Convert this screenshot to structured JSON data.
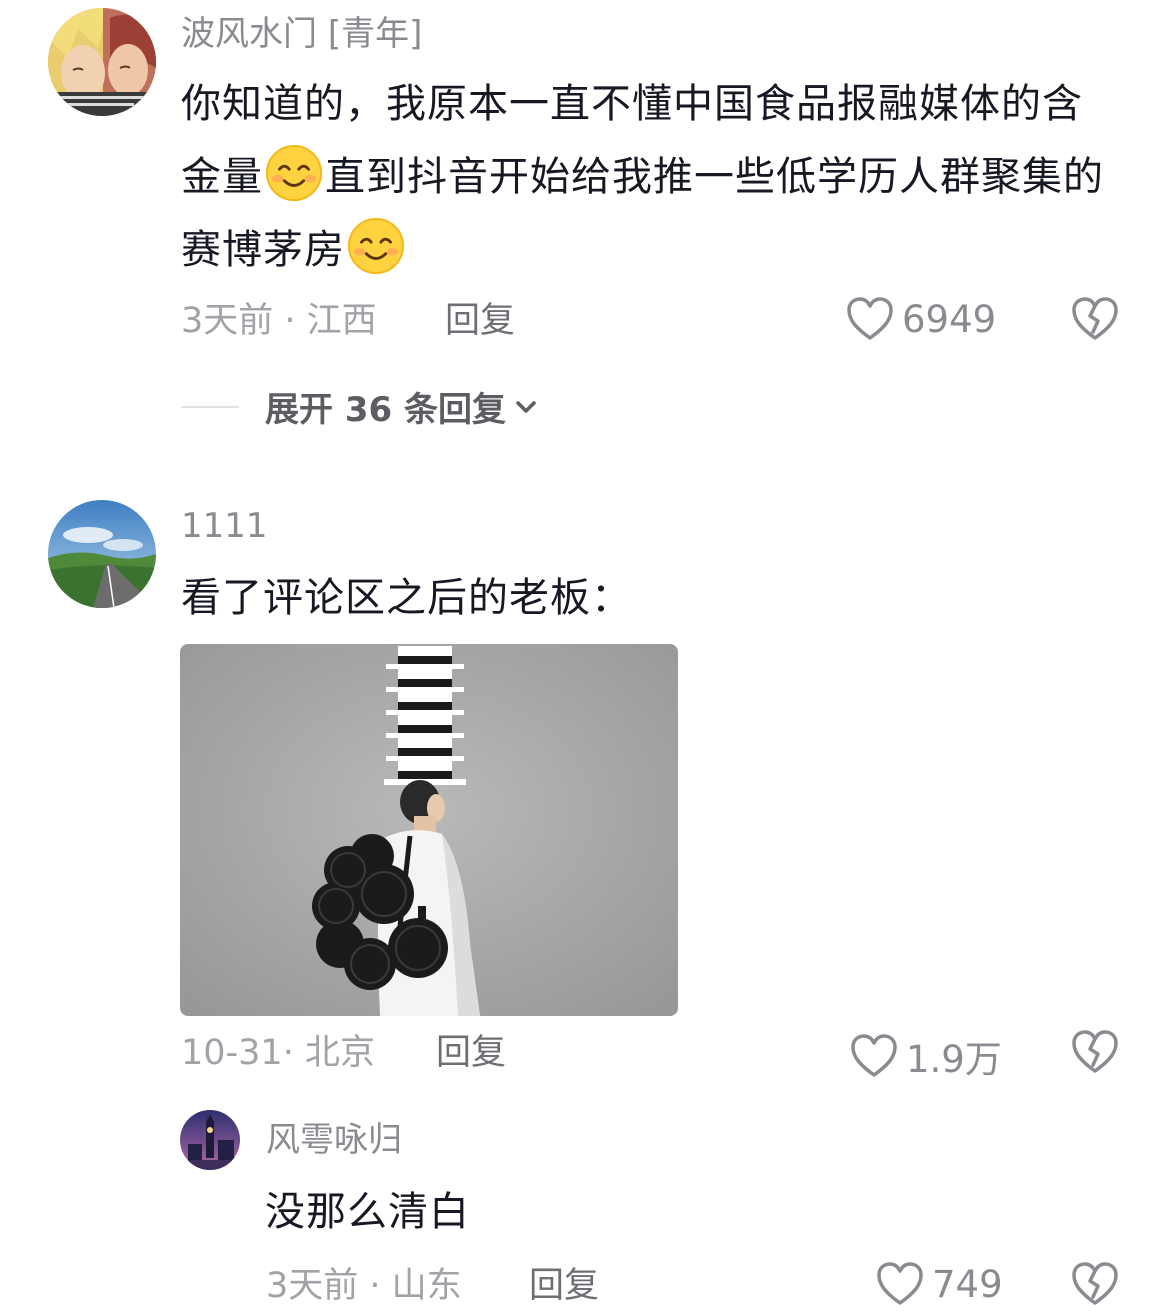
{
  "comments": [
    {
      "username": "波风水门",
      "tag": "[青年]",
      "text_parts": [
        "你知道的，我原本一直不懂中国食品报融媒体的含金量",
        "直到抖音开始给我推一些低学历人群聚集的赛博茅房"
      ],
      "emoji_name": "smile-emoji",
      "meta": "3天前 · 江西",
      "reply_label": "回复",
      "likes": "6949",
      "expand_label": "展开 36 条回复"
    },
    {
      "username": "1111",
      "text": "看了评论区之后的老板：",
      "meta": "10-31· 北京",
      "reply_label": "回复",
      "likes": "1.9万"
    },
    {
      "username": "风雩咏归",
      "text": "没那么清白",
      "meta": "3天前 · 山东",
      "reply_label": "回复",
      "likes": "749"
    }
  ],
  "colors": {
    "text": "#161823",
    "secondary": "#8a8b91",
    "meta": "#a2a3a8"
  },
  "icons": {
    "like": "heart-outline-icon",
    "dislike": "broken-heart-icon",
    "expand": "chevron-down-icon"
  }
}
